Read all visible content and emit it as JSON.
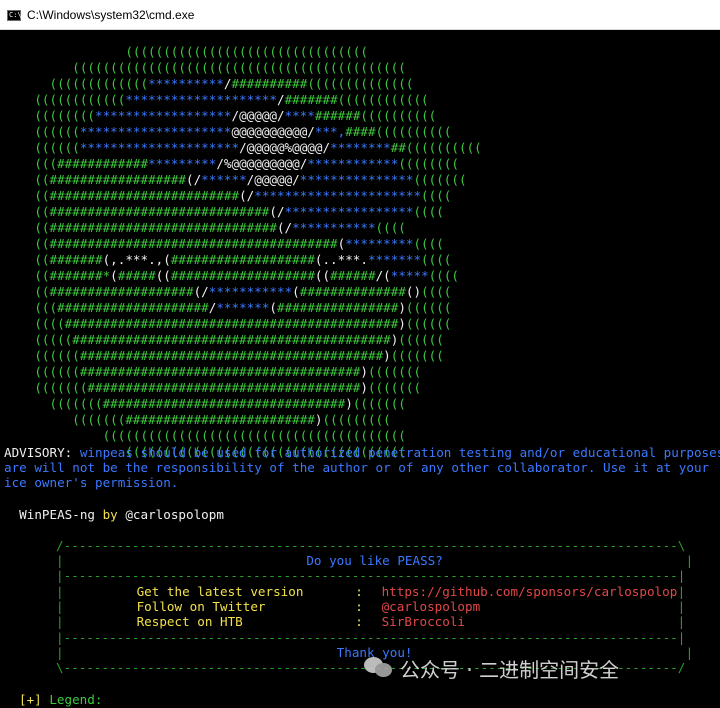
{
  "window": {
    "title": "C:\\Windows\\system32\\cmd.exe",
    "icon_text": "C:\\_"
  },
  "ascii_art": [
    {
      "parts": [
        [
          "g",
          "                (((((((((((((((((((((((((((((((("
        ]
      ]
    },
    {
      "parts": [
        [
          "g",
          "         (((((((((((((((((((((((((((((((((((((((((((("
        ]
      ]
    },
    {
      "parts": [
        [
          "g",
          "      ((((((((((((("
        ],
        [
          "b",
          "**********"
        ],
        [
          "w",
          "/"
        ],
        [
          "g",
          "##########"
        ],
        [
          "g",
          "(((((((((((((("
        ]
      ]
    },
    {
      "parts": [
        [
          "g",
          "    (((((((((((("
        ],
        [
          "b",
          "********************"
        ],
        [
          "w",
          "/"
        ],
        [
          "g",
          "#######"
        ],
        [
          "g",
          "(((((((((((("
        ]
      ]
    },
    {
      "parts": [
        [
          "g",
          "    (((((((("
        ],
        [
          "b",
          "******************"
        ],
        [
          "w",
          "/@@@@@/"
        ],
        [
          "b",
          "****"
        ],
        [
          "g",
          "######"
        ],
        [
          "g",
          "(((((((((("
        ]
      ]
    },
    {
      "parts": [
        [
          "g",
          "    (((((("
        ],
        [
          "b",
          "********************"
        ],
        [
          "w",
          "@@@@@@@@@@/"
        ],
        [
          "b",
          "***,"
        ],
        [
          "g",
          "####"
        ],
        [
          "g",
          "(((((((((("
        ]
      ]
    },
    {
      "parts": [
        [
          "g",
          "    (((((("
        ],
        [
          "b",
          "*********************"
        ],
        [
          "w",
          "/@@@@@%@@@@/"
        ],
        [
          "b",
          "********"
        ],
        [
          "g",
          "##"
        ],
        [
          "g",
          "(((((((((("
        ]
      ]
    },
    {
      "parts": [
        [
          "g",
          "    ((("
        ],
        [
          "g",
          "############"
        ],
        [
          "b",
          "*********"
        ],
        [
          "w",
          "/%@@@@@@@@@/"
        ],
        [
          "b",
          "************"
        ],
        [
          "g",
          "(((((((("
        ]
      ]
    },
    {
      "parts": [
        [
          "g",
          "    (("
        ],
        [
          "g",
          "##################"
        ],
        [
          "w",
          "(/"
        ],
        [
          "b",
          "******"
        ],
        [
          "w",
          "/@@@@@/"
        ],
        [
          "b",
          "***************"
        ],
        [
          "g",
          "((((((("
        ]
      ]
    },
    {
      "parts": [
        [
          "g",
          "    (("
        ],
        [
          "g",
          "#########################"
        ],
        [
          "w",
          "(/"
        ],
        [
          "b",
          "**********************"
        ],
        [
          "g",
          "(((("
        ]
      ]
    },
    {
      "parts": [
        [
          "g",
          "    (("
        ],
        [
          "g",
          "#############################"
        ],
        [
          "w",
          "(/"
        ],
        [
          "b",
          "*****************"
        ],
        [
          "g",
          "(((("
        ]
      ]
    },
    {
      "parts": [
        [
          "g",
          "    (("
        ],
        [
          "g",
          "##############################"
        ],
        [
          "w",
          "(/"
        ],
        [
          "b",
          "***********"
        ],
        [
          "g",
          "(((("
        ]
      ]
    },
    {
      "parts": [
        [
          "g",
          "    (("
        ],
        [
          "g",
          "######################################"
        ],
        [
          "w",
          "("
        ],
        [
          "b",
          "*********"
        ],
        [
          "g",
          "(((("
        ]
      ]
    },
    {
      "parts": [
        [
          "g",
          "    (("
        ],
        [
          "g",
          "#######"
        ],
        [
          "w",
          "(,.***.,("
        ],
        [
          "g",
          "###################"
        ],
        [
          "w",
          "(..***."
        ],
        [
          "b",
          "*******"
        ],
        [
          "g",
          "(((("
        ]
      ]
    },
    {
      "parts": [
        [
          "g",
          "    (("
        ],
        [
          "g",
          "#######*"
        ],
        [
          "w",
          "("
        ],
        [
          "g",
          "#####"
        ],
        [
          "w",
          "(("
        ],
        [
          "g",
          "###################"
        ],
        [
          "w",
          "(("
        ],
        [
          "g",
          "######"
        ],
        [
          "w",
          "/("
        ],
        [
          "b",
          "*****"
        ],
        [
          "g",
          "(((("
        ]
      ]
    },
    {
      "parts": [
        [
          "g",
          "    (("
        ],
        [
          "g",
          "###################"
        ],
        [
          "w",
          "(/"
        ],
        [
          "b",
          "***********"
        ],
        [
          "w",
          "("
        ],
        [
          "g",
          "##############"
        ],
        [
          "w",
          "()"
        ],
        [
          "g",
          "(((("
        ]
      ]
    },
    {
      "parts": [
        [
          "g",
          "    ((("
        ],
        [
          "g",
          "####################"
        ],
        [
          "w",
          "/"
        ],
        [
          "b",
          "*******"
        ],
        [
          "w",
          "("
        ],
        [
          "g",
          "################"
        ],
        [
          "w",
          ")"
        ],
        [
          "g",
          "(((((("
        ]
      ]
    },
    {
      "parts": [
        [
          "g",
          "    (((("
        ],
        [
          "g",
          "############################################"
        ],
        [
          "w",
          ")"
        ],
        [
          "g",
          "(((((("
        ]
      ]
    },
    {
      "parts": [
        [
          "g",
          "    ((((("
        ],
        [
          "g",
          "##########################################"
        ],
        [
          "w",
          ")"
        ],
        [
          "g",
          "(((((("
        ]
      ]
    },
    {
      "parts": [
        [
          "g",
          "    (((((("
        ],
        [
          "g",
          "########################################"
        ],
        [
          "w",
          ")"
        ],
        [
          "g",
          "((((((("
        ]
      ]
    },
    {
      "parts": [
        [
          "g",
          "    (((((("
        ],
        [
          "g",
          "#####################################"
        ],
        [
          "w",
          ")"
        ],
        [
          "g",
          "((((((("
        ]
      ]
    },
    {
      "parts": [
        [
          "g",
          "    ((((((("
        ],
        [
          "g",
          "####################################"
        ],
        [
          "w",
          ")"
        ],
        [
          "g",
          "((((((("
        ]
      ]
    },
    {
      "parts": [
        [
          "g",
          "      ((((((("
        ],
        [
          "g",
          "################################"
        ],
        [
          "w",
          ")"
        ],
        [
          "g",
          "((((((("
        ]
      ]
    },
    {
      "parts": [
        [
          "g",
          "         ((((((("
        ],
        [
          "g",
          "#########################"
        ],
        [
          "w",
          ")"
        ],
        [
          "g",
          "((((((((("
        ]
      ]
    },
    {
      "parts": [
        [
          "g",
          "             (((((((((((((((((((((((((((((((((((((((("
        ]
      ]
    },
    {
      "parts": [
        [
          "g",
          "                ((((((((((((((((((((((((((((((((((((("
        ]
      ]
    }
  ],
  "advisory": {
    "label": "ADVISORY:",
    "line1": " winpeas should be used for authorized penetration testing and/or educational purposes only.",
    "line2": "are will not be the responsibility of the author or of any other collaborator. Use it at your",
    "line3": "ice owner's permission."
  },
  "banner": {
    "name": "WinPEAS-ng",
    "by": " by ",
    "handle": "@carlospolopm"
  },
  "box": {
    "top_border": "/---------------------------------------------------------------------------------\\",
    "divider": "|---------------------------------------------------------------------------------|",
    "bottom_border": "\\---------------------------------------------------------------------------------/",
    "question": "Do you like PEASS?",
    "rows": [
      {
        "label": "Get the latest version",
        "value": "https://github.com/sponsors/carlospolop"
      },
      {
        "label": "Follow on Twitter",
        "value": "@carlospolopm"
      },
      {
        "label": "Respect on HTB",
        "value": "SirBroccoli"
      }
    ],
    "separator": ":",
    "thanks": "Thank you!"
  },
  "legend": {
    "marker": "[+]",
    "label": " Legend:"
  },
  "watermark": {
    "text": "公众号 · 二进制空间安全"
  },
  "colors": {
    "green": "#3ec73e",
    "blue": "#3b78ff",
    "white": "#f0f0f0",
    "yellow": "#f2e14c",
    "red": "#e04848",
    "background": "#000000"
  }
}
